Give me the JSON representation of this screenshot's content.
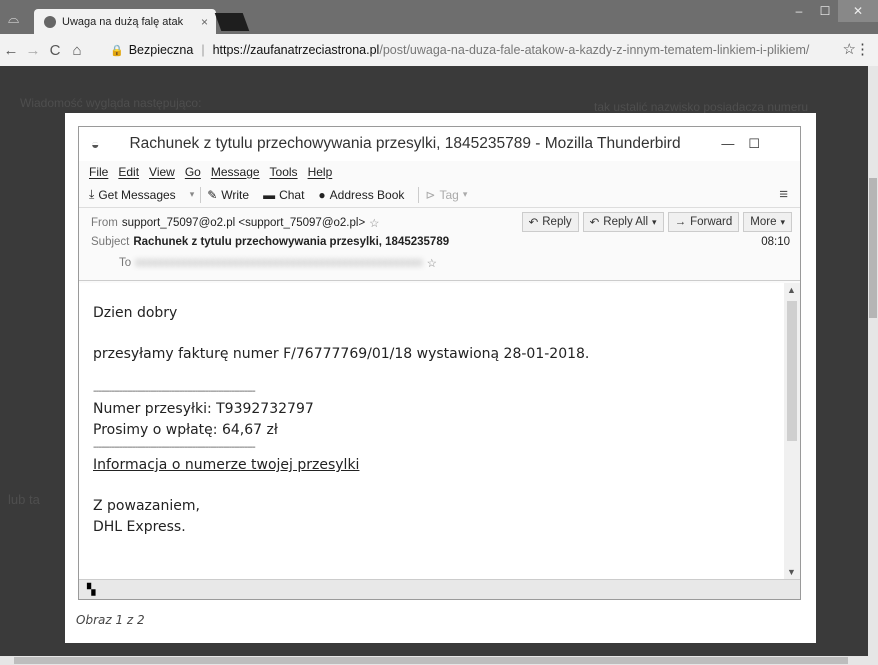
{
  "browser": {
    "tab_title": "Uwaga na dużą falę atak",
    "tab_close": "×",
    "secure_label": "Bezpieczna",
    "url_host": "https://zaufanatrzeciastrona.pl",
    "url_path": "/post/uwaga-na-duza-fale-atakow-a-kazdy-z-innym-tematem-linkiem-i-plikiem/"
  },
  "page": {
    "bg_text_1": "Wiadomość wygląda następująco:",
    "bg_text_2": "tak ustalić nazwisko posiadacza numeru",
    "bg_text_3": "lub ta"
  },
  "lightbox": {
    "caption": "Obraz 1 z 2"
  },
  "thunderbird": {
    "window_title": "Rachunek z tytulu przechowywania przesylki, 1845235789 - Mozilla Thunderbird",
    "menu": [
      "File",
      "Edit",
      "View",
      "Go",
      "Message",
      "Tools",
      "Help"
    ],
    "toolbar": {
      "get_messages": "Get Messages",
      "write": "Write",
      "chat": "Chat",
      "address_book": "Address Book",
      "tag": "Tag"
    },
    "header": {
      "from_label": "From",
      "from_value": "support_75097@o2.pl <support_75097@o2.pl>",
      "subject_label": "Subject",
      "subject_value": "Rachunek z tytulu przechowywania przesylki, 1845235789",
      "to_label": "To",
      "to_value": "xxxxxxxxxxxxxxxxxxxxxxxxxxxxxxxxxxxxxxxxxxxxxxxxxx",
      "time": "08:10",
      "reply": "Reply",
      "reply_all": "Reply All",
      "forward": "Forward",
      "more": "More"
    },
    "body": {
      "greeting": "Dzien dobry",
      "invoice_line": "przesyłamy fakturę numer F/76777769/01/18 wystawioną 28-01-2018.",
      "separator": "--------------------------------------------------------------",
      "tracking_number": "Numer przesyłki: T9392732797",
      "payment": "Prosimy o wpłatę: 64,67 zł",
      "link_text": "Informacja o numerze twojej przesylki",
      "closing": "Z powazaniem,",
      "signature": "DHL Express."
    }
  }
}
